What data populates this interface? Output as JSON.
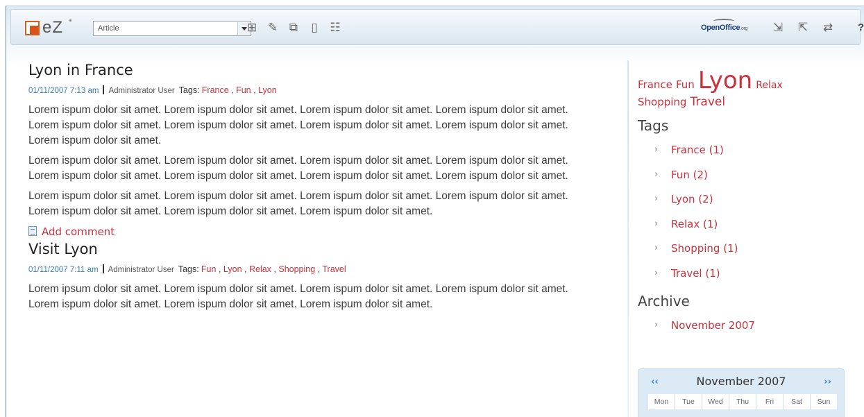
{
  "toolbar": {
    "logo_text": "eZ",
    "class_select": "Article",
    "icons": [
      "new-icon",
      "edit-icon",
      "move-icon",
      "remove-icon",
      "sitemap-icon"
    ],
    "openoffice_text": "OpenOffice",
    "openoffice_suffix": ".org",
    "oo_icons": [
      "import-icon",
      "export-icon",
      "replace-icon"
    ],
    "help_label": "?"
  },
  "posts": [
    {
      "title": "Lyon in France",
      "date": "01/11/2007 7:13 am",
      "author": "Administrator User",
      "tags_label": "Tags:",
      "tags": [
        "France",
        "Fun",
        "Lyon"
      ],
      "paragraphs": [
        "Lorem ispum dolor sit amet. Lorem ispum dolor sit amet. Lorem ispum dolor sit amet. Lorem ispum dolor sit amet. Lorem ispum dolor sit amet. Lorem ispum dolor sit amet. Lorem ispum dolor sit amet. Lorem ispum dolor sit amet. Lorem ispum dolor sit amet.",
        "Lorem ispum dolor sit amet. Lorem ispum dolor sit amet. Lorem ispum dolor sit amet. Lorem ispum dolor sit amet. Lorem ispum dolor sit amet. Lorem ispum dolor sit amet. Lorem ispum dolor sit amet. Lorem ispum dolor sit amet.",
        "Lorem ispum dolor sit amet. Lorem ispum dolor sit amet. Lorem ispum dolor sit amet. Lorem ispum dolor sit amet. Lorem ispum dolor sit amet. Lorem ispum dolor sit amet. Lorem ispum dolor sit amet."
      ],
      "add_comment": "Add comment"
    },
    {
      "title": "Visit Lyon",
      "date": "01/11/2007 7:11 am",
      "author": "Administrator User",
      "tags_label": "Tags:",
      "tags": [
        "Fun",
        "Lyon",
        "Relax",
        "Shopping",
        "Travel"
      ],
      "paragraphs": [
        "Lorem ipsum dolor sit amet. Lorem ispum dolor sit amet. Lorem ispum dolor sit amet. Lorem ispum dolor sit amet. Lorem ispum dolor sit amet. Lorem ispum dolor sit amet. Lorem ispum dolor sit amet."
      ]
    }
  ],
  "sidebar": {
    "cloud": [
      {
        "label": "France",
        "size": 15
      },
      {
        "label": "Fun",
        "size": 15
      },
      {
        "label": "Lyon",
        "size": 34
      },
      {
        "label": "Relax",
        "size": 14
      },
      {
        "label": "Shopping",
        "size": 15
      },
      {
        "label": "Travel",
        "size": 17
      }
    ],
    "tags_heading": "Tags",
    "tags": [
      "France (1)",
      "Fun (2)",
      "Lyon (2)",
      "Relax (1)",
      "Shopping (1)",
      "Travel (1)"
    ],
    "archive_heading": "Archive",
    "archive": [
      "November 2007"
    ]
  },
  "calendar": {
    "prev": "‹‹",
    "next": "››",
    "title": "November 2007",
    "days": [
      "Mon",
      "Tue",
      "Wed",
      "Thu",
      "Fri",
      "Sat",
      "Sun"
    ]
  },
  "colors": {
    "link_red": "#c8323c",
    "date_blue": "#3b7cb8",
    "accent_orange": "#d9541a"
  }
}
